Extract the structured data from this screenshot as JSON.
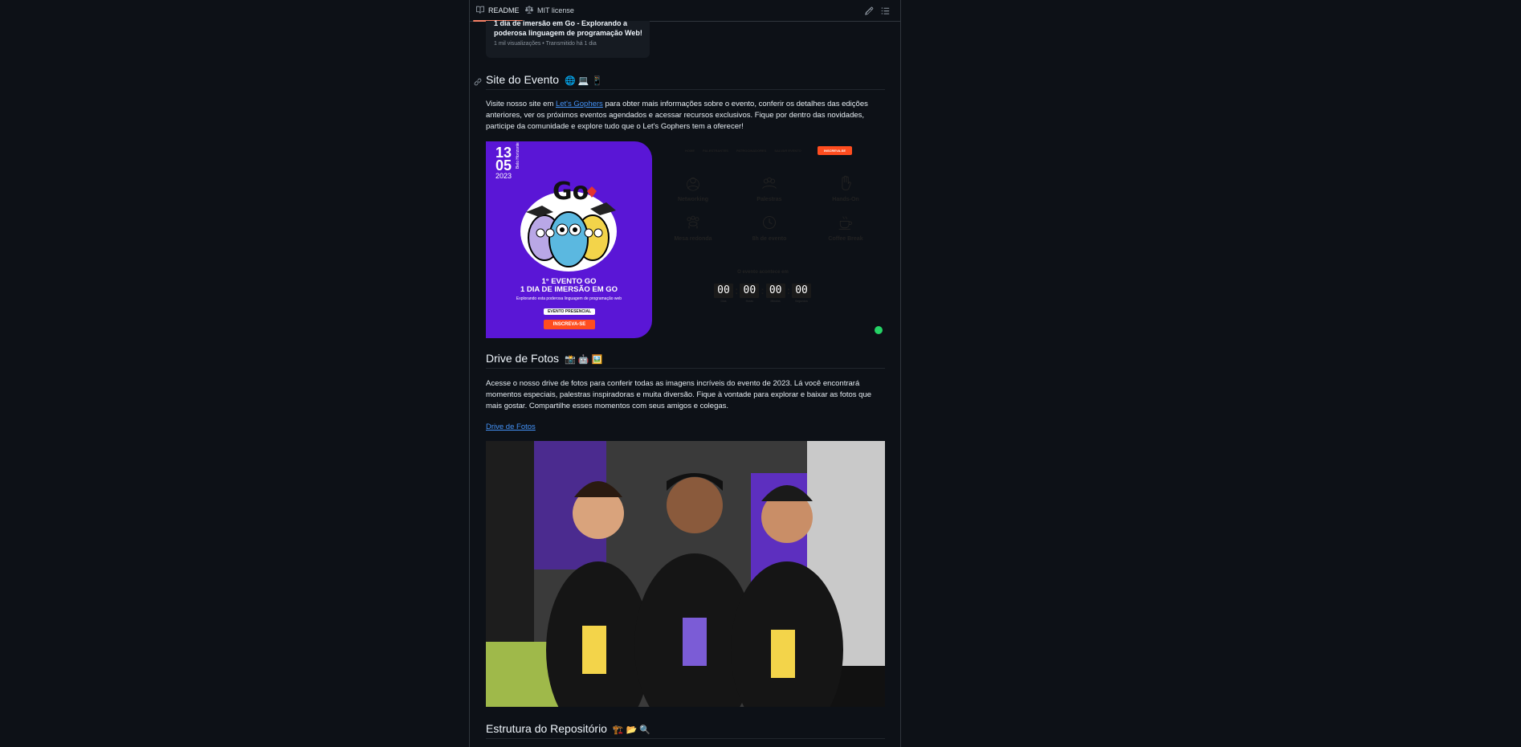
{
  "tabs": {
    "readme": "README",
    "license": "MIT license"
  },
  "video": {
    "title": "1 dia de imersão em Go - Explorando a poderosa linguagem de programação Web!",
    "meta": "1 mil visualizações • Transmitido há 1 dia"
  },
  "site_section": {
    "heading": "Site do Evento",
    "emojis": "🌐 💻 📱",
    "text_before": "Visite nosso site em ",
    "link": "Let's Gophers",
    "text_after": " para obter mais informações sobre o evento, conferir os detalhes das edições anteriores, ver os próximos eventos agendados e acessar recursos exclusivos. Fique por dentro das novidades, participe da comunidade e explore tudo que o Let's Gophers tem a oferecer!"
  },
  "banner": {
    "day": "13",
    "month": "05",
    "year": "2023",
    "city": "Belo Horizonte",
    "event_line1": "1° EVENTO GO",
    "event_line2": "1 DIA DE IMERSÃO EM GO",
    "event_sub": "Explorando esta poderosa linguagem de programação web",
    "presencial": "EVENTO PRESENCIAL",
    "signup": "INSCREVA-SE",
    "nav": [
      "HOME",
      "PALESTRANTES",
      "PATROCINADORES",
      "SALVAR EVENTO"
    ],
    "nav_cta": "INSCREVA-SE",
    "features": [
      "Networking",
      "Palestras",
      "Hands-On",
      "Mesa redonda",
      "8h de evento",
      "Coffee Break"
    ],
    "countdown_title": "O evento acontece em",
    "countdown": [
      {
        "value": "00",
        "label": "Dias"
      },
      {
        "value": "00",
        "label": "Horas"
      },
      {
        "value": "00",
        "label": "Minutos"
      },
      {
        "value": "00",
        "label": "Segundos"
      }
    ]
  },
  "drive_section": {
    "heading": "Drive de Fotos",
    "emojis": "📸 🤖 🖼️",
    "text": "Acesse o nosso drive de fotos para conferir todas as imagens incríveis do evento de 2023. Lá você encontrará momentos especiais, palestras inspiradoras e muita diversão. Fique à vontade para explorar e baixar as fotos que mais gostar. Compartilhe esses momentos com seus amigos e colegas.",
    "link": "Drive de Fotos"
  },
  "repo_section": {
    "heading": "Estrutura do Repositório",
    "emojis": "🏗️ 📂 🔍"
  },
  "colors": {
    "background": "#0d1117",
    "link": "#4493f8",
    "tab_underline": "#f78166",
    "banner_purple": "#5a16d6",
    "banner_yellow": "#e8fa6a",
    "cta_orange": "#ff4d1f"
  }
}
